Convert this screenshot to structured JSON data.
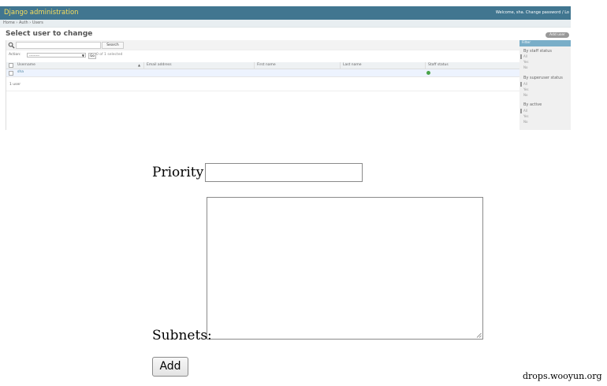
{
  "admin": {
    "branding": "Django administration",
    "user_tools": "Welcome, sha. Change password / Lo",
    "breadcrumbs": "Home › Auth › Users",
    "page_title": "Select user to change",
    "add_user_label": "Add user",
    "search": {
      "button_label": "Search",
      "value": ""
    },
    "actions": {
      "label": "Action:",
      "selected": "---------",
      "go_label": "Go",
      "counter": "0 of 1 selected"
    },
    "table": {
      "columns": [
        "Username",
        "Email address",
        "First name",
        "Last name",
        "Staff status"
      ],
      "rows": [
        {
          "username": "sha",
          "email": "",
          "first_name": "",
          "last_name": "",
          "staff_status": true
        }
      ]
    },
    "result_count": "1 user",
    "filter": {
      "title": "Filter",
      "groups": [
        {
          "title": "By staff status",
          "options": [
            "All",
            "Yes",
            "No"
          ]
        },
        {
          "title": "By superuser status",
          "options": [
            "All",
            "Yes",
            "No"
          ]
        },
        {
          "title": "By active",
          "options": [
            "All",
            "Yes",
            "No"
          ]
        }
      ]
    },
    "colors": {
      "header": "#417690",
      "branding": "#f5dd5d",
      "filter_title": "#79aec8",
      "selected_row": "#edf3fe",
      "staff_ok": "#49a349"
    }
  },
  "form": {
    "priority_label": "Priority:",
    "priority_value": "",
    "subnets_label": "Subnets:",
    "subnets_value": "",
    "add_button_label": "Add"
  },
  "watermark": "drops.wooyun.org"
}
